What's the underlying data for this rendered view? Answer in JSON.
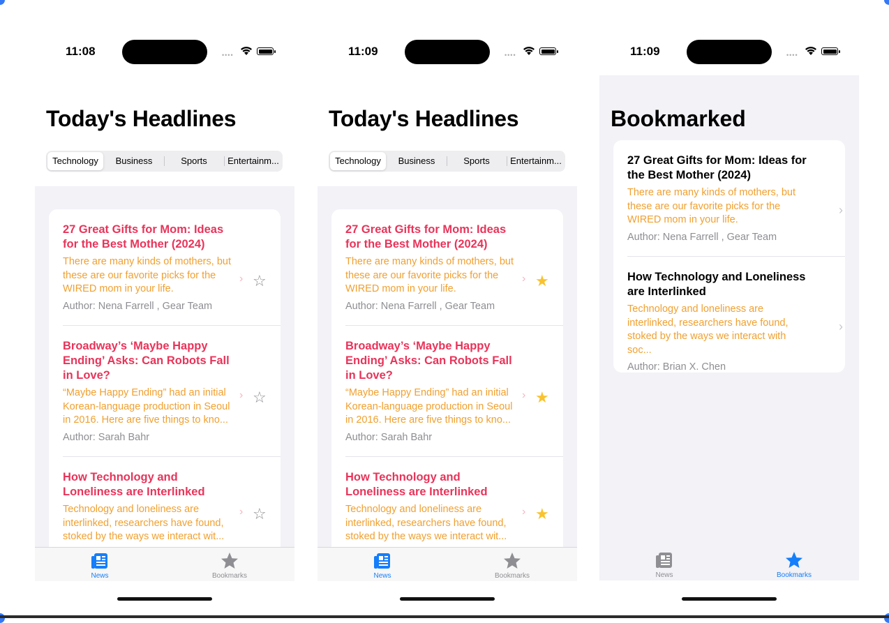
{
  "colors": {
    "accent": "#e8345a",
    "summary": "#f0a030",
    "tab_active": "#147efb",
    "star": "#f9c22e"
  },
  "screens": [
    {
      "time": "11:08",
      "title": "Today's Headlines",
      "segments": [
        "Technology",
        "Business",
        "Sports",
        "Entertainm..."
      ],
      "selected_segment": "Technology",
      "articles": [
        {
          "headline": "27 Great Gifts for Mom: Ideas for the Best Mother (2024)",
          "summary": "There are many kinds of mothers, but these are our favorite picks for the WIRED mom in your life.",
          "author": "Author: Nena Farrell , Gear Team",
          "star": "☆"
        },
        {
          "headline": "Broadway’s ‘Maybe Happy Ending’ Asks: Can Robots Fall in Love?",
          "summary": "“Maybe Happy Ending” had an initial Korean-language production in Seoul in 2016. Here are five things to kno...",
          "author": "Author: Sarah Bahr",
          "star": "☆"
        },
        {
          "headline": "How Technology and Loneliness are Interlinked",
          "summary": "Technology and loneliness are interlinked, researchers have found, stoked by the ways we interact wit...",
          "author": "",
          "star": "☆"
        }
      ],
      "tabs": [
        "News",
        "Bookmarks"
      ],
      "active_tab": "News"
    },
    {
      "time": "11:09",
      "title": "Today's Headlines",
      "segments": [
        "Technology",
        "Business",
        "Sports",
        "Entertainm..."
      ],
      "selected_segment": "Technology",
      "articles": [
        {
          "headline": "27 Great Gifts for Mom: Ideas for the Best Mother (2024)",
          "summary": "There are many kinds of mothers, but these are our favorite picks for the WIRED mom in your life.",
          "author": "Author: Nena Farrell , Gear Team",
          "star": "★"
        },
        {
          "headline": "Broadway’s ‘Maybe Happy Ending’ Asks: Can Robots Fall in Love?",
          "summary": "“Maybe Happy Ending” had an initial Korean-language production in Seoul in 2016. Here are five things to kno...",
          "author": "Author: Sarah Bahr",
          "star": "★"
        },
        {
          "headline": "How Technology and Loneliness are Interlinked",
          "summary": "Technology and loneliness are interlinked, researchers have found, stoked by the ways we interact wit...",
          "author": "",
          "star": "★"
        }
      ],
      "tabs": [
        "News",
        "Bookmarks"
      ],
      "active_tab": "News"
    },
    {
      "time": "11:09",
      "title": "Bookmarked",
      "articles": [
        {
          "headline": "27 Great Gifts for Mom: Ideas for the Best Mother (2024)",
          "summary": "There are many kinds of mothers, but these are our favorite picks for the WIRED mom in your life.",
          "author": "Author: Nena Farrell , Gear Team"
        },
        {
          "headline": "How Technology and Loneliness are Interlinked",
          "summary": "Technology and loneliness are interlinked, researchers have found, stoked by the ways we interact with soc...",
          "author": "Author: Brian X. Chen"
        }
      ],
      "tabs": [
        "News",
        "Bookmarks"
      ],
      "active_tab": "Bookmarks"
    }
  ]
}
